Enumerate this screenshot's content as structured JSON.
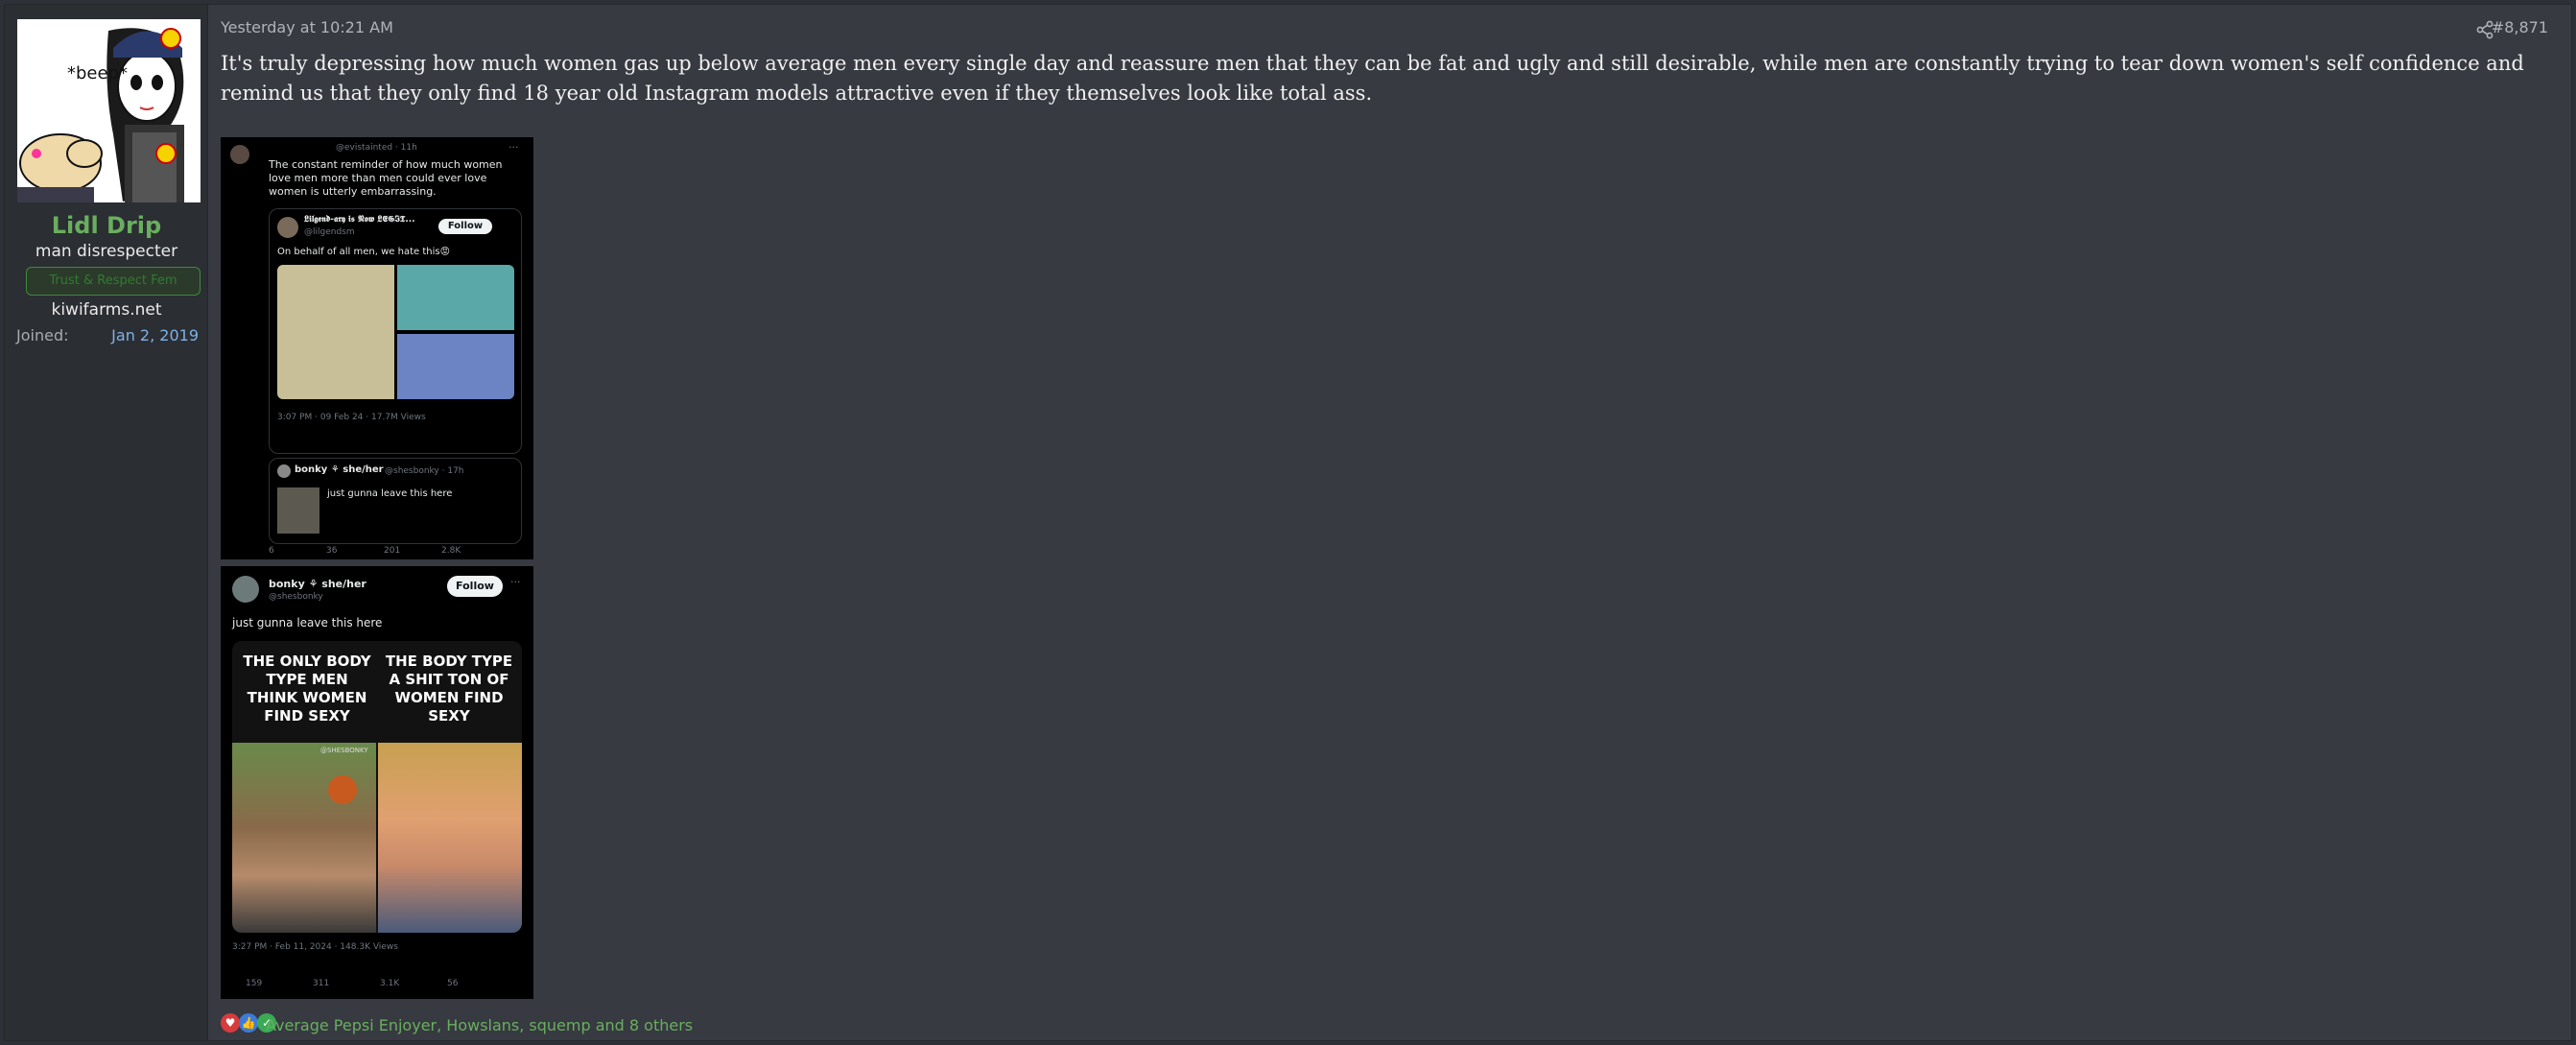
{
  "user": {
    "name": "Lidl Drip",
    "title": "man disrespecter",
    "banner": "Trust & Respect Fem",
    "site": "kiwifarms.net",
    "joined_label": "Joined:",
    "joined_value": "Jan 2, 2019",
    "avatar_caption": "*beep*"
  },
  "post": {
    "timestamp": "Yesterday at 10:21 AM",
    "number": "#8,871",
    "body": "It's truly depressing how much women gas up below average men every single day and reassure men that they can be fat and ugly and still desirable, while men are constantly trying to tear down women's self confidence and remind us that they only find 18 year old Instagram models attractive even if they themselves look like total ass."
  },
  "embed1": {
    "handle": "@evistainted · 11h",
    "text": "The constant reminder of how much women love men more than men could ever love women is utterly embarrassing.",
    "quote_name": "𝕷𝖎𝖑𝖌𝖊𝖓𝖉-𝖆𝖗𝖞 𝖎𝖘 𝕹𝖔𝖜 𝕷𝕰𝕲𝕴𝕿...",
    "quote_handle": "@lilgendsm",
    "quote_follow": "Follow",
    "quote_text": "On behalf of all men, we hate this😡",
    "quote_meta": "3:07 PM · 09 Feb 24 · 17.7M Views",
    "reply_name": "bonky ⚘ she/her",
    "reply_handle": "@shesbonky · 17h",
    "reply_text": "just gunna leave this here",
    "stats": [
      "6",
      "36",
      "201",
      "2.8K"
    ]
  },
  "embed2": {
    "name": "bonky ⚘ she/her",
    "handle": "@shesbonky",
    "follow": "Follow",
    "text": "just gunna leave this here",
    "left_caption": "THE ONLY BODY TYPE MEN THINK WOMEN FIND SEXY",
    "right_caption": "THE BODY TYPE A SHIT TON OF WOMEN FIND SEXY",
    "watermark": "@SHESBONKY",
    "meta": "3:27 PM · Feb 11, 2024 · 148.3K Views",
    "stats": [
      "159",
      "311",
      "3.1K",
      "56"
    ]
  },
  "reactions": {
    "text": "Average Pepsi Enjoyer, Howslans, squemp and 8 others",
    "icons": [
      "heart-icon",
      "thumbs-up-icon",
      "check-icon"
    ]
  }
}
